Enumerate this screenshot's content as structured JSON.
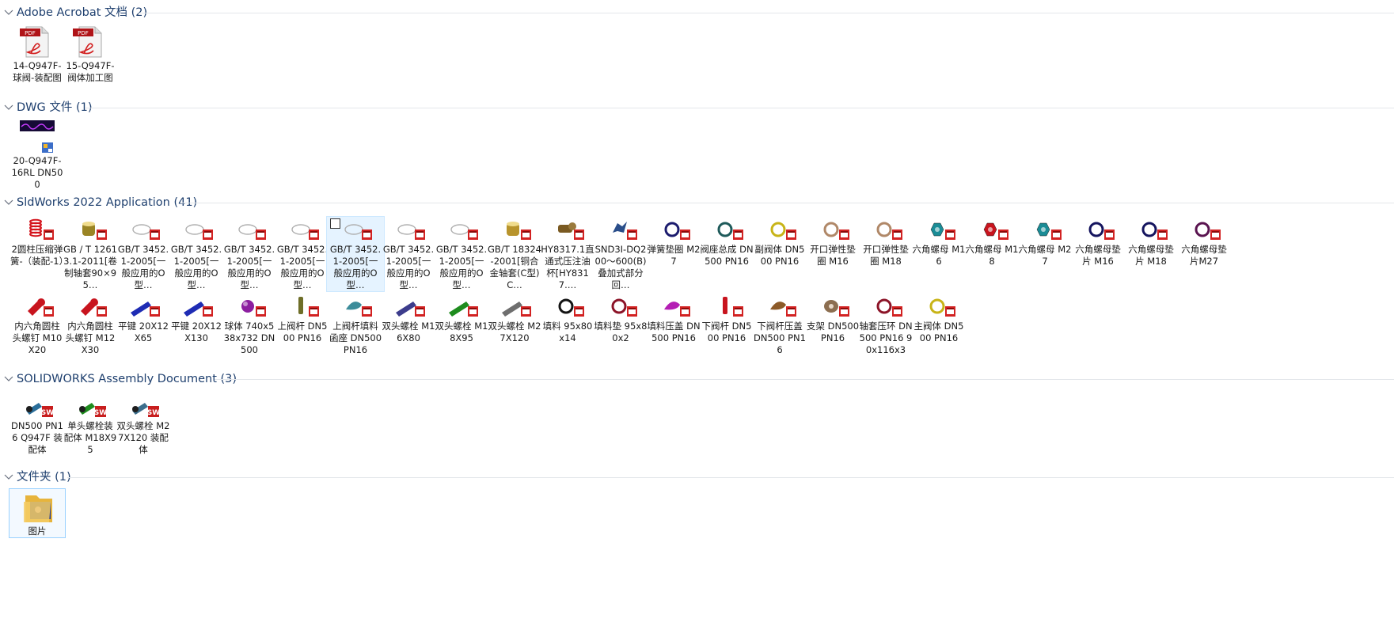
{
  "groups": [
    {
      "title": "Adobe Acrobat 文档 (2)",
      "items": [
        {
          "label": "14-Q947F-球阀-装配图",
          "icon": "pdf-icon"
        },
        {
          "label": "15-Q947F-阀体加工图",
          "icon": "pdf-icon"
        }
      ]
    },
    {
      "title": "DWG 文件 (1)",
      "items": [
        {
          "label": "20-Q947F-16RL DN500",
          "icon": "dwg-icon"
        }
      ]
    },
    {
      "title": "SldWorks 2022 Application (41)",
      "items": [
        {
          "label": "2圆柱压缩弹簧-（装配-1）",
          "icon": "spring-part-icon",
          "color": "#d4141c"
        },
        {
          "label": "GB / T 12613.1-2011[卷制轴套90×95…",
          "icon": "bushing-part-icon",
          "color": "#9a8424"
        },
        {
          "label": "GB/T 3452.1-2005[一般应用的O型…",
          "icon": "o-ring-part-icon",
          "color": "#b0b0b0"
        },
        {
          "label": "GB/T 3452.1-2005[一般应用的O型…",
          "icon": "o-ring-part-icon",
          "color": "#b0b0b0"
        },
        {
          "label": "GB/T 3452.1-2005[一般应用的O型…",
          "icon": "o-ring-part-icon",
          "color": "#b0b0b0"
        },
        {
          "label": "GB/T 3452.1-2005[一般应用的O型…",
          "icon": "o-ring-part-icon",
          "color": "#b0b0b0"
        },
        {
          "label": "GB/T 3452.1-2005[一般应用的O型…",
          "icon": "o-ring-part-icon",
          "color": "#b0b0b0",
          "selected": true
        },
        {
          "label": "GB/T 3452.1-2005[一般应用的O型…",
          "icon": "o-ring-part-icon",
          "color": "#b0b0b0"
        },
        {
          "label": "GB/T 3452.1-2005[一般应用的O型…",
          "icon": "o-ring-part-icon",
          "color": "#b0b0b0"
        },
        {
          "label": "GB/T 18324-2001[铜合金轴套(C型)C…",
          "icon": "bushing-part-icon",
          "color": "#b8942c"
        },
        {
          "label": "HY8317.1直通式压注油杯[HY8317.…",
          "icon": "grease-nipple-part-icon",
          "color": "#7a5a22"
        },
        {
          "label": "SND3I-DQ200～600(B)叠加式部分回…",
          "icon": "assembly-part-icon",
          "color": "#2a4e8a"
        },
        {
          "label": "弹簧垫圈 M27",
          "icon": "ring-part-icon",
          "color": "#1c1c6e"
        },
        {
          "label": "阀座总成 DN500 PN16",
          "icon": "ring-part-icon",
          "color": "#1e5a5a"
        },
        {
          "label": "副阀体 DN500 PN16",
          "icon": "ring-part-icon",
          "color": "#c8b418"
        },
        {
          "label": "开口弹性垫圈  M16",
          "icon": "ring-part-icon",
          "color": "#b08868"
        },
        {
          "label": "开口弹性垫圈  M18",
          "icon": "ring-part-icon",
          "color": "#b08868"
        },
        {
          "label": "六角螺母 M16",
          "icon": "hex-nut-part-icon",
          "color": "#1a8c96"
        },
        {
          "label": "六角螺母 M18",
          "icon": "hex-nut-part-icon",
          "color": "#c8141e"
        },
        {
          "label": "六角螺母 M27",
          "icon": "hex-nut-part-icon",
          "color": "#1a8c96"
        },
        {
          "label": "六角螺母垫片  M16",
          "icon": "ring-part-icon",
          "color": "#14145e"
        },
        {
          "label": "六角螺母垫片  M18",
          "icon": "ring-part-icon",
          "color": "#14145e"
        },
        {
          "label": "六角螺母垫片M27",
          "icon": "ring-part-icon",
          "color": "#5a1450"
        },
        {
          "label": "内六角圆柱头螺钉 M10X20",
          "icon": "screw-part-icon",
          "color": "#c8141e"
        },
        {
          "label": "内六角圆柱头螺钉 M12X30",
          "icon": "screw-part-icon",
          "color": "#c8141e"
        },
        {
          "label": "平键 20X12X65",
          "icon": "key-part-icon",
          "color": "#1e2cb4"
        },
        {
          "label": "平键 20X12X130",
          "icon": "key-part-icon",
          "color": "#1e2cb4"
        },
        {
          "label": "球体 740x538x732 DN500",
          "icon": "ball-part-icon",
          "color": "#8c1ea0"
        },
        {
          "label": "上阀杆 DN500 PN16",
          "icon": "stem-part-icon",
          "color": "#6e6e28"
        },
        {
          "label": "上阀杆填料函座 DN500 PN16",
          "icon": "gland-part-icon",
          "color": "#3c8c9a"
        },
        {
          "label": "双头螺栓 M16X80",
          "icon": "stud-part-icon",
          "color": "#3c3c8c"
        },
        {
          "label": "双头螺栓 M18X95",
          "icon": "stud-part-icon",
          "color": "#1e8c1e"
        },
        {
          "label": "双头螺栓 M27X120",
          "icon": "stud-part-icon",
          "color": "#6e6e6e"
        },
        {
          "label": "填料 95x80x14",
          "icon": "ring-part-icon",
          "color": "#141414"
        },
        {
          "label": "填料垫 95x80x2",
          "icon": "ring-part-icon",
          "color": "#8c1428"
        },
        {
          "label": "填料压盖 DN500 PN16",
          "icon": "gland-part-icon",
          "color": "#b41eb4"
        },
        {
          "label": "下阀杆 DN500 PN16",
          "icon": "stem-part-icon",
          "color": "#c8141e"
        },
        {
          "label": "下阀杆压盖 DN500 PN16",
          "icon": "gland-part-icon",
          "color": "#8c5a28"
        },
        {
          "label": "支架 DN500 PN16",
          "icon": "bracket-part-icon",
          "color": "#8c6e50"
        },
        {
          "label": "轴套压环 DN500 PN16 90x116x3",
          "icon": "ring-part-icon",
          "color": "#8c1428"
        },
        {
          "label": "主阀体 DN500 PN16",
          "icon": "ring-part-icon",
          "color": "#c8b418"
        }
      ]
    },
    {
      "title": "SOLIDWORKS Assembly Document (3)",
      "items": [
        {
          "label": "DN500 PN16 Q947F 装配体",
          "icon": "assembly-doc-icon",
          "color": "#2a6e9a"
        },
        {
          "label": "单头螺栓装配体 M18X95",
          "icon": "assembly-doc-icon",
          "color": "#1e8c1e"
        },
        {
          "label": "双头螺栓 M27X120 装配体",
          "icon": "assembly-doc-icon",
          "color": "#3c6e8c"
        }
      ]
    },
    {
      "title": "文件夹 (1)",
      "items": [
        {
          "label": "图片",
          "icon": "folder-icon",
          "selected": true
        }
      ]
    }
  ]
}
